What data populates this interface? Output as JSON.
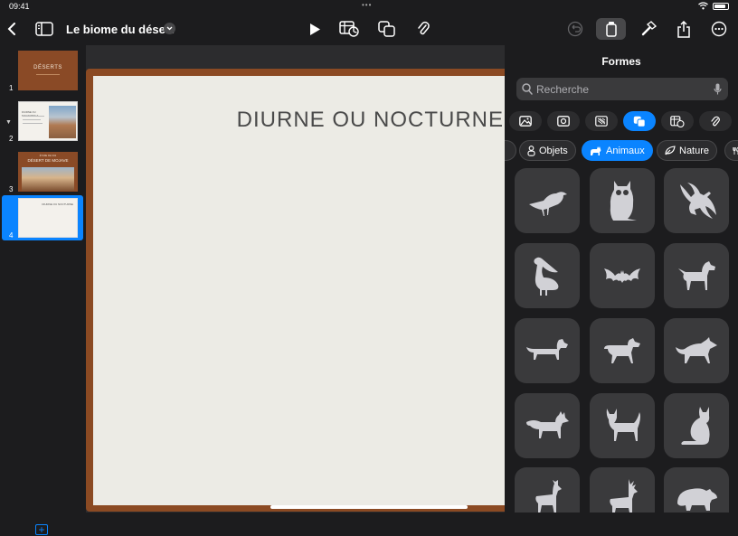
{
  "status_bar": {
    "time": "09:41",
    "dots": "•••"
  },
  "document": {
    "title": "Le biome du désert"
  },
  "navigator": {
    "slides": [
      {
        "number": "1",
        "thumb_text": "DÉSERTS"
      },
      {
        "number": "2",
        "thumb_text": "DIURNE OU NOCTURNE ?"
      },
      {
        "number": "3",
        "thumb_text": "DÉSERT DE MOJAVE",
        "thumb_subtext": "ÉTUDE DE CAS"
      },
      {
        "number": "4",
        "thumb_text": "DIURNE OU NOCTURNE"
      }
    ],
    "selected_index": 3
  },
  "slide": {
    "heading": "DIURNE OU NOCTURNE"
  },
  "panel": {
    "title": "Formes",
    "search_placeholder": "Recherche",
    "type_tabs": [
      "image-icon",
      "media-icon",
      "chart-icon",
      "shapes-icon",
      "table-icon",
      "attachment-icon"
    ],
    "categories": [
      {
        "label": "",
        "icon": "partial-icon"
      },
      {
        "label": "Objets",
        "icon": "objects-icon"
      },
      {
        "label": "Animaux",
        "icon": "cat-icon",
        "active": true
      },
      {
        "label": "Nature",
        "icon": "leaf-icon"
      },
      {
        "label": "",
        "icon": "food-icon"
      }
    ],
    "shapes": [
      "crow",
      "owl",
      "eagle",
      "pelican",
      "bat",
      "dog",
      "dachshund",
      "dog-walking",
      "wolf",
      "fox",
      "cat",
      "cat-sitting",
      "deer",
      "stag",
      "bear"
    ]
  },
  "colors": {
    "accent": "#0a84ff",
    "slide_border": "#8b4a23",
    "slide_paper": "#ecebe5",
    "tile": "#3a3a3c"
  }
}
